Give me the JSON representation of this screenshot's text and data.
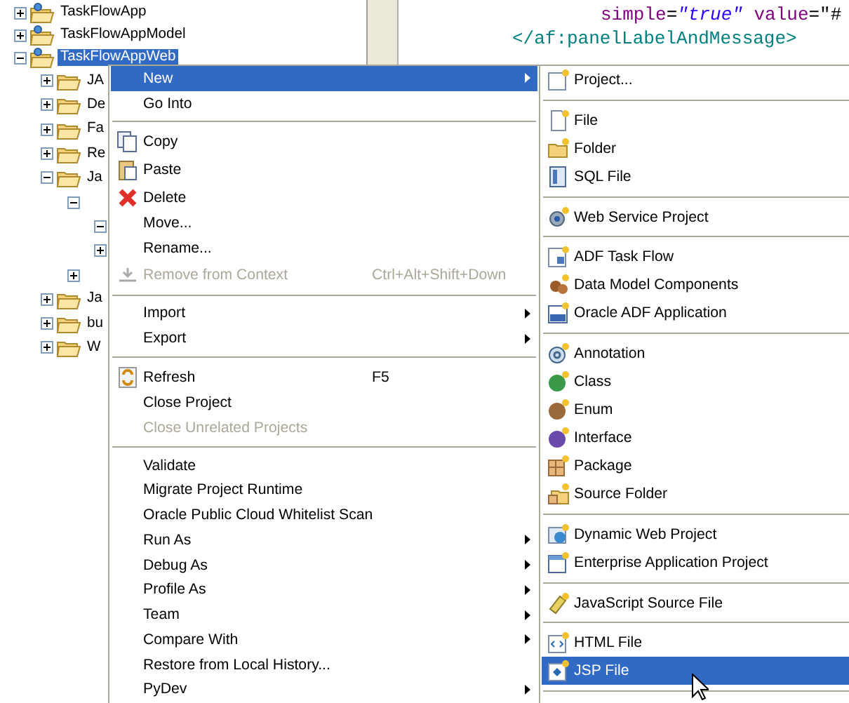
{
  "tree": [
    {
      "label": "TaskFlowApp",
      "expanded": false,
      "selected": false
    },
    {
      "label": "TaskFlowAppModel",
      "expanded": false,
      "selected": false
    },
    {
      "label": "TaskFlowAppWeb",
      "expanded": true,
      "selected": true,
      "children": [
        {
          "label": "JA",
          "expanded": false
        },
        {
          "label": "De",
          "expanded": false
        },
        {
          "label": "Fa",
          "expanded": false
        },
        {
          "label": "Re",
          "expanded": false
        },
        {
          "label": "Ja",
          "expanded": true,
          "children": [
            {
              "expanded": true,
              "children": [
                {
                  "expanded": true
                },
                {
                  "expanded": false
                }
              ]
            },
            {
              "expanded": false
            }
          ]
        },
        {
          "label": "Ja",
          "expanded": false
        },
        {
          "label": "bu",
          "expanded": false
        },
        {
          "label": "W",
          "expanded": false
        }
      ]
    }
  ],
  "editor": {
    "code_lines": [
      {
        "tokens": [
          {
            "kind": "attribute",
            "text": "simple"
          },
          {
            "kind": "operator",
            "text": "="
          },
          {
            "kind": "string",
            "text": "\"true\""
          },
          {
            "kind": "attribute",
            "text": " value"
          },
          {
            "kind": "operator",
            "text": "=\"#"
          }
        ]
      },
      {
        "tokens": [
          {
            "kind": "tag",
            "text": "</af:panelLabelAndMessage>"
          }
        ]
      }
    ]
  },
  "context_menu": {
    "items": [
      {
        "kind": "item",
        "label": "New",
        "selected": true,
        "submenu": true
      },
      {
        "kind": "item",
        "label": "Go Into"
      },
      {
        "kind": "separator"
      },
      {
        "kind": "item",
        "label": "Copy"
      },
      {
        "kind": "item",
        "label": "Paste"
      },
      {
        "kind": "item",
        "label": "Delete"
      },
      {
        "kind": "item",
        "label": "Move..."
      },
      {
        "kind": "item",
        "label": "Rename..."
      },
      {
        "kind": "item",
        "label": "Remove from Context",
        "disabled": true,
        "shortcut": "Ctrl+Alt+Shift+Down"
      },
      {
        "kind": "separator"
      },
      {
        "kind": "item",
        "label": "Import",
        "submenu": true
      },
      {
        "kind": "item",
        "label": "Export",
        "submenu": true
      },
      {
        "kind": "separator"
      },
      {
        "kind": "item",
        "label": "Refresh",
        "shortcut": "F5"
      },
      {
        "kind": "item",
        "label": "Close Project"
      },
      {
        "kind": "item",
        "label": "Close Unrelated Projects",
        "disabled": true
      },
      {
        "kind": "separator"
      },
      {
        "kind": "item",
        "label": "Validate"
      },
      {
        "kind": "item",
        "label": "Migrate Project Runtime"
      },
      {
        "kind": "item",
        "label": "Oracle Public Cloud Whitelist Scan"
      },
      {
        "kind": "item",
        "label": "Run As",
        "submenu": true
      },
      {
        "kind": "item",
        "label": "Debug As",
        "submenu": true
      },
      {
        "kind": "item",
        "label": "Profile As",
        "submenu": true
      },
      {
        "kind": "item",
        "label": "Team",
        "submenu": true
      },
      {
        "kind": "item",
        "label": "Compare With",
        "submenu": true
      },
      {
        "kind": "item",
        "label": "Restore from Local History..."
      },
      {
        "kind": "item",
        "label": "PyDev",
        "submenu": true
      }
    ]
  },
  "new_submenu": {
    "items": [
      {
        "kind": "item",
        "label": "Project..."
      },
      {
        "kind": "separator"
      },
      {
        "kind": "item",
        "label": "File"
      },
      {
        "kind": "item",
        "label": "Folder"
      },
      {
        "kind": "item",
        "label": "SQL File"
      },
      {
        "kind": "separator"
      },
      {
        "kind": "item",
        "label": "Web Service Project"
      },
      {
        "kind": "separator"
      },
      {
        "kind": "item",
        "label": "ADF Task Flow"
      },
      {
        "kind": "item",
        "label": "Data Model Components"
      },
      {
        "kind": "item",
        "label": "Oracle ADF Application"
      },
      {
        "kind": "separator"
      },
      {
        "kind": "item",
        "label": "Annotation"
      },
      {
        "kind": "item",
        "label": "Class"
      },
      {
        "kind": "item",
        "label": "Enum"
      },
      {
        "kind": "item",
        "label": "Interface"
      },
      {
        "kind": "item",
        "label": "Package"
      },
      {
        "kind": "item",
        "label": "Source Folder"
      },
      {
        "kind": "separator"
      },
      {
        "kind": "item",
        "label": "Dynamic Web Project"
      },
      {
        "kind": "item",
        "label": "Enterprise Application Project"
      },
      {
        "kind": "separator"
      },
      {
        "kind": "item",
        "label": "JavaScript Source File"
      },
      {
        "kind": "separator"
      },
      {
        "kind": "item",
        "label": "HTML File"
      },
      {
        "kind": "item",
        "label": "JSP File",
        "selected": true
      },
      {
        "kind": "separator"
      }
    ]
  }
}
